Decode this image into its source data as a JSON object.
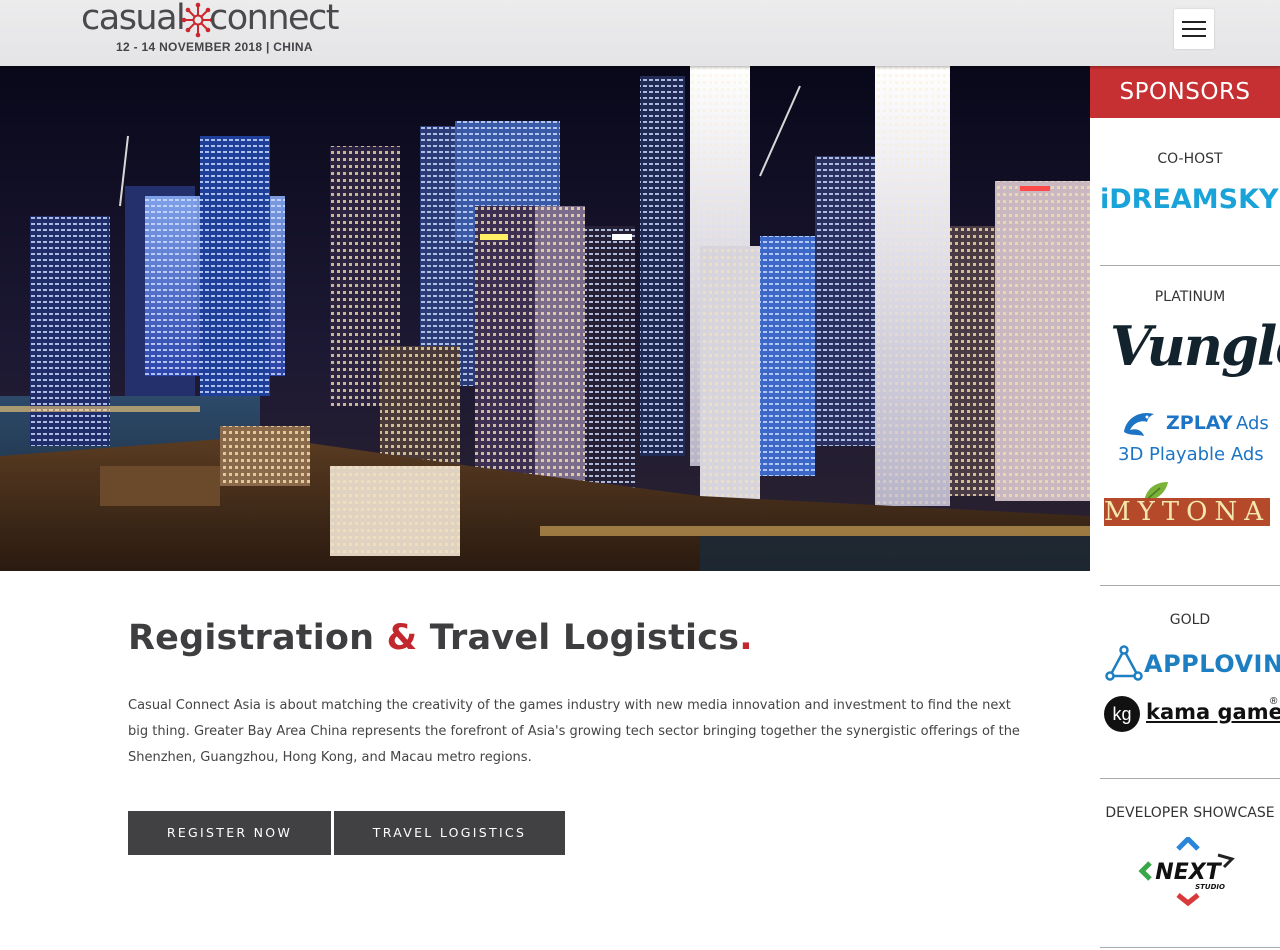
{
  "header": {
    "logo_casual": "casual",
    "logo_connect": "connect",
    "event_dates": "12 - 14 NOVEMBER 2018 | CHINA",
    "menu_icon": "hamburger-menu-icon"
  },
  "hero": {
    "image_alt": "night city skyline"
  },
  "main": {
    "title_part1": "Registration",
    "title_amp": "&",
    "title_part2": "Travel Logistics",
    "title_dot": ".",
    "intro": "Casual Connect Asia is about matching the creativity of the games industry with new media innovation and investment to find the next big thing. Greater Bay Area China represents the forefront of Asia's growing tech sector bringing together the synergistic offerings of the Shenzhen, Guangzhou, Hong Kong, and Macau metro regions.",
    "buttons": {
      "register": "REGISTER NOW",
      "travel": "TRAVEL LOGISTICS"
    }
  },
  "sponsors": {
    "heading": "SPONSORS",
    "tiers": {
      "cohost": "CO-HOST",
      "platinum": "PLATINUM",
      "gold": "GOLD",
      "showcase": "DEVELOPER SHOWCASE"
    },
    "logos": {
      "idreamsky": "iDREAMSKY",
      "vungle": "Vungle",
      "zplay_name": "ZPLAY",
      "zplay_ads": "Ads",
      "zplay_sub": "3D Playable Ads",
      "mytona": "MYTONA",
      "applovin": "APPLOVIN",
      "kama_mark": "kg",
      "kama": "kama games",
      "kama_reg": "®",
      "next": "NEXT",
      "next_sub": "STUDIO"
    },
    "colors": {
      "header_bg": "#c73032",
      "idreamsky": "#1aa3d8",
      "zplay": "#1d74c5",
      "applovin": "#1d7fc2"
    }
  },
  "colors": {
    "accent_red": "#c2272d",
    "button_bg": "#414143",
    "text_dark": "#3e3e40"
  }
}
